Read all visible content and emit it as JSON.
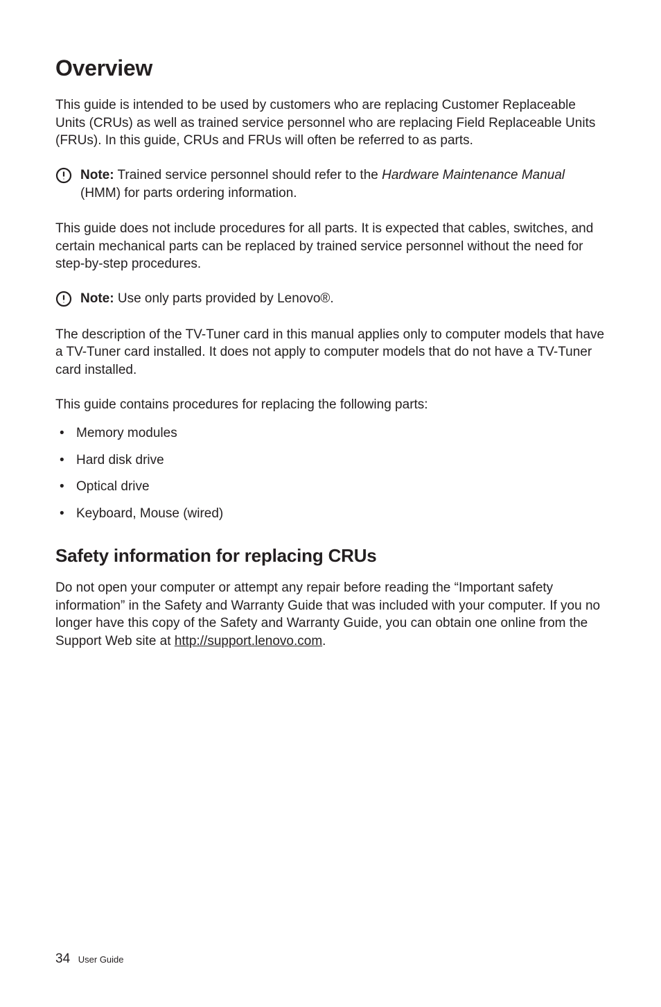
{
  "heading": "Overview",
  "intro": "This guide is intended to be used by customers who are replacing Customer Replaceable Units (CRUs) as well as trained service personnel who are replacing Field Replaceable Units (FRUs). In this guide, CRUs and FRUs will often be referred to as parts.",
  "note1": {
    "label": "Note:",
    "text_before_italic": " Trained service personnel should refer to the ",
    "italic": "Hardware Maintenance Manual",
    "text_after_italic": " (HMM) for parts ordering information."
  },
  "para2": "This guide does not include procedures for all parts. It is expected that cables, switches, and certain mechanical parts can be replaced by trained service personnel without the need for step-by-step procedures.",
  "note2": {
    "label": "Note:",
    "text": " Use only parts provided by Lenovo®."
  },
  "para3": "The description of the TV-Tuner card in this manual applies only to computer models that have a TV-Tuner card installed. It does not apply to computer models that do not have a TV-Tuner card installed.",
  "parts_intro": "This guide contains procedures for replacing the following parts:",
  "parts": [
    "Memory modules",
    "Hard disk drive",
    "Optical drive",
    "Keyboard, Mouse (wired)"
  ],
  "subheading": "Safety information for replacing CRUs",
  "safety": {
    "text_before_link": "Do not open your computer or attempt any repair before reading the “Important safety information” in the Safety and Warranty Guide that was included with your computer. If you no longer have this copy of the Safety and Warranty Guide, you can obtain one online from the Support Web site at ",
    "link": "http://support.lenovo.com",
    "text_after_link": "."
  },
  "footer": {
    "page": "34",
    "label": "User Guide"
  }
}
